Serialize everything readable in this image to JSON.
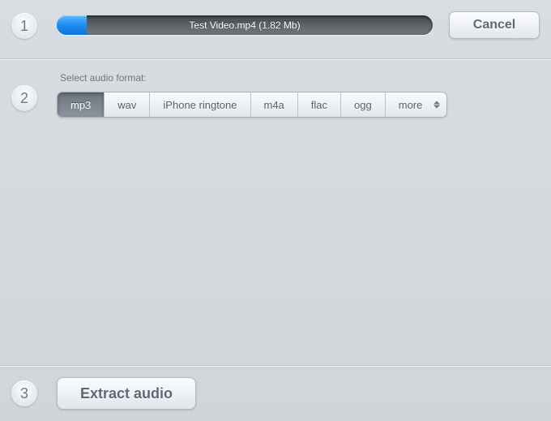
{
  "steps": {
    "one": "1",
    "two": "2",
    "three": "3"
  },
  "upload": {
    "filename_display": "Test Video.mp4 (1.82 Mb)",
    "cancel_label": "Cancel"
  },
  "format": {
    "label": "Select audio format:",
    "options": [
      "mp3",
      "wav",
      "iPhone ringtone",
      "m4a",
      "flac",
      "ogg"
    ],
    "more_label": "more",
    "selected_index": 0
  },
  "action": {
    "extract_label": "Extract audio"
  }
}
